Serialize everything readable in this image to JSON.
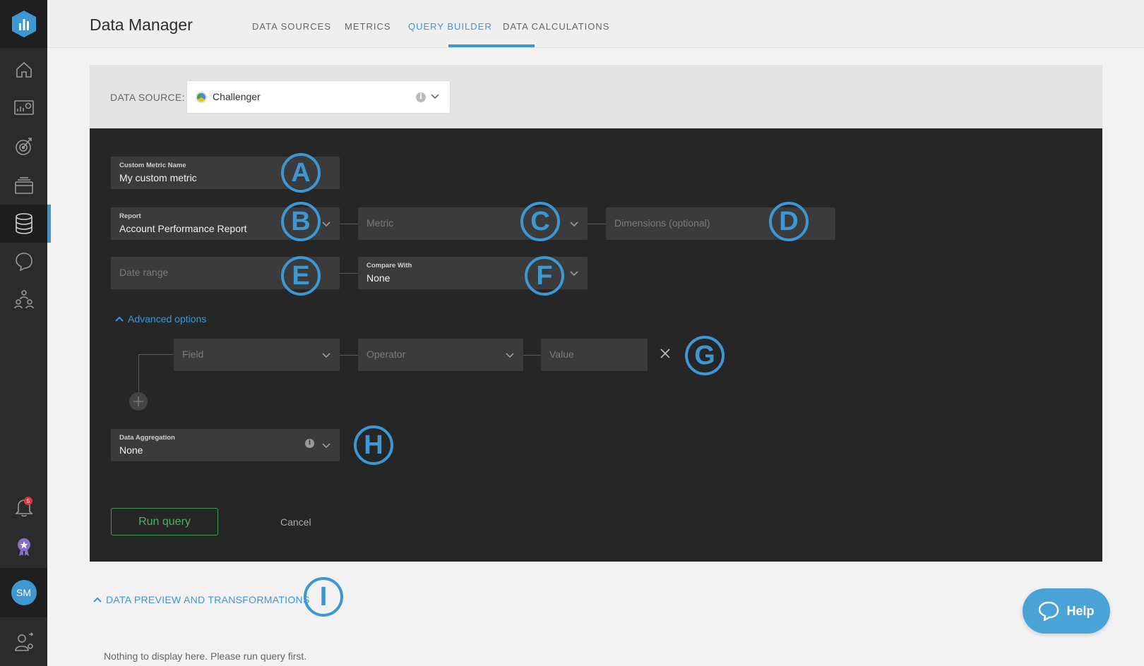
{
  "header": {
    "title": "Data Manager",
    "tabs": [
      {
        "label": "DATA SOURCES",
        "active": false
      },
      {
        "label": "METRICS",
        "active": false
      },
      {
        "label": "QUERY BUILDER",
        "active": true
      },
      {
        "label": "DATA CALCULATIONS",
        "active": false
      }
    ]
  },
  "sidebar": {
    "items": [
      "home-icon",
      "dashboard-icon",
      "goals-icon",
      "reports-icon",
      "data-icon",
      "chat-icon",
      "team-icon"
    ],
    "notification_count": "5",
    "avatar_initials": "SM"
  },
  "data_source": {
    "label": "DATA SOURCE:",
    "value": "Challenger"
  },
  "form": {
    "metric_name": {
      "label": "Custom Metric Name",
      "value": "My custom metric"
    },
    "report": {
      "label": "Report",
      "value": "Account Performance Report"
    },
    "metric": {
      "placeholder": "Metric"
    },
    "dimensions": {
      "placeholder": "Dimensions (optional)"
    },
    "date_range": {
      "placeholder": "Date range"
    },
    "compare_with": {
      "label": "Compare With",
      "value": "None"
    },
    "advanced_label": "Advanced options",
    "filter": {
      "field_placeholder": "Field",
      "operator_placeholder": "Operator",
      "value_placeholder": "Value"
    },
    "aggregation": {
      "label": "Data Aggregation",
      "value": "None"
    },
    "run_label": "Run query",
    "cancel_label": "Cancel"
  },
  "markers": [
    "A",
    "B",
    "C",
    "D",
    "E",
    "F",
    "G",
    "H",
    "I"
  ],
  "preview": {
    "toggle_label": "DATA PREVIEW AND TRANSFORMATIONS",
    "empty_message": "Nothing to display here. Please run query first."
  },
  "help": {
    "label": "Help"
  },
  "colors": {
    "accent": "#3d97d3",
    "panel": "#262626",
    "run": "#49b06a"
  }
}
